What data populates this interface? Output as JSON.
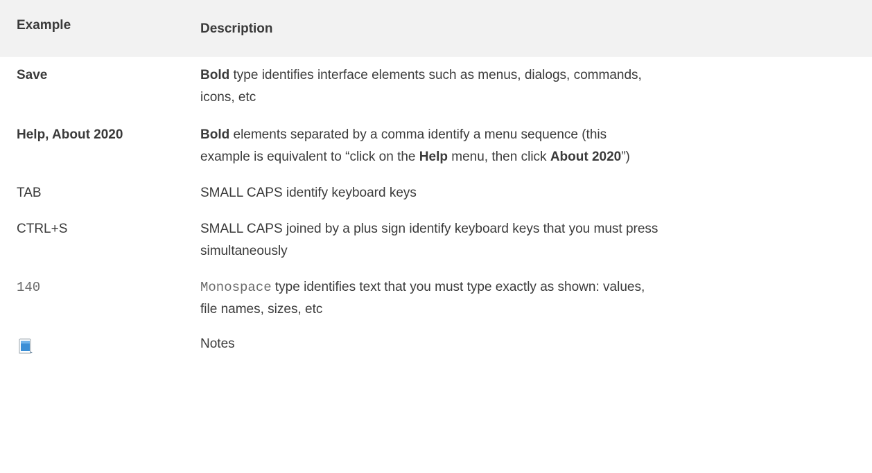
{
  "header": {
    "col1": "Example",
    "col2": "Description"
  },
  "rows": [
    {
      "example": "Save",
      "desc": {
        "b1": "Bold",
        "t1": " type identifies interface elements such as menus, dialogs, commands,",
        "t2": "icons, etc"
      }
    },
    {
      "example": "Help, About 2020",
      "desc": {
        "b1": "Bold",
        "t1": " elements separated by a comma identify a menu sequence (this",
        "t2a": "example is equivalent to “click on the ",
        "b2": "Help",
        "t2b": " menu, then click ",
        "b3": "About 2020",
        "t2c": "”)"
      }
    },
    {
      "example": "TAB",
      "desc": {
        "t1": "SMALL CAPS identify keyboard keys"
      }
    },
    {
      "example": "CTRL+S",
      "desc": {
        "t1": "SMALL CAPS joined by a plus sign identify keyboard keys that you must press",
        "t2": "simultaneously"
      }
    },
    {
      "example": "140",
      "desc": {
        "m1": "Monospace",
        "t1": " type identifies text that you must type exactly as shown: values,",
        "t2": "file names, sizes, etc"
      }
    },
    {
      "icon": "notepad-icon",
      "desc": {
        "t1": "Notes"
      }
    }
  ],
  "colors": {
    "header_bg": "#f2f2f2",
    "text": "#3a3a3a",
    "mono_text": "#6a6a6a",
    "icon_blue": "#3b8fd6"
  }
}
